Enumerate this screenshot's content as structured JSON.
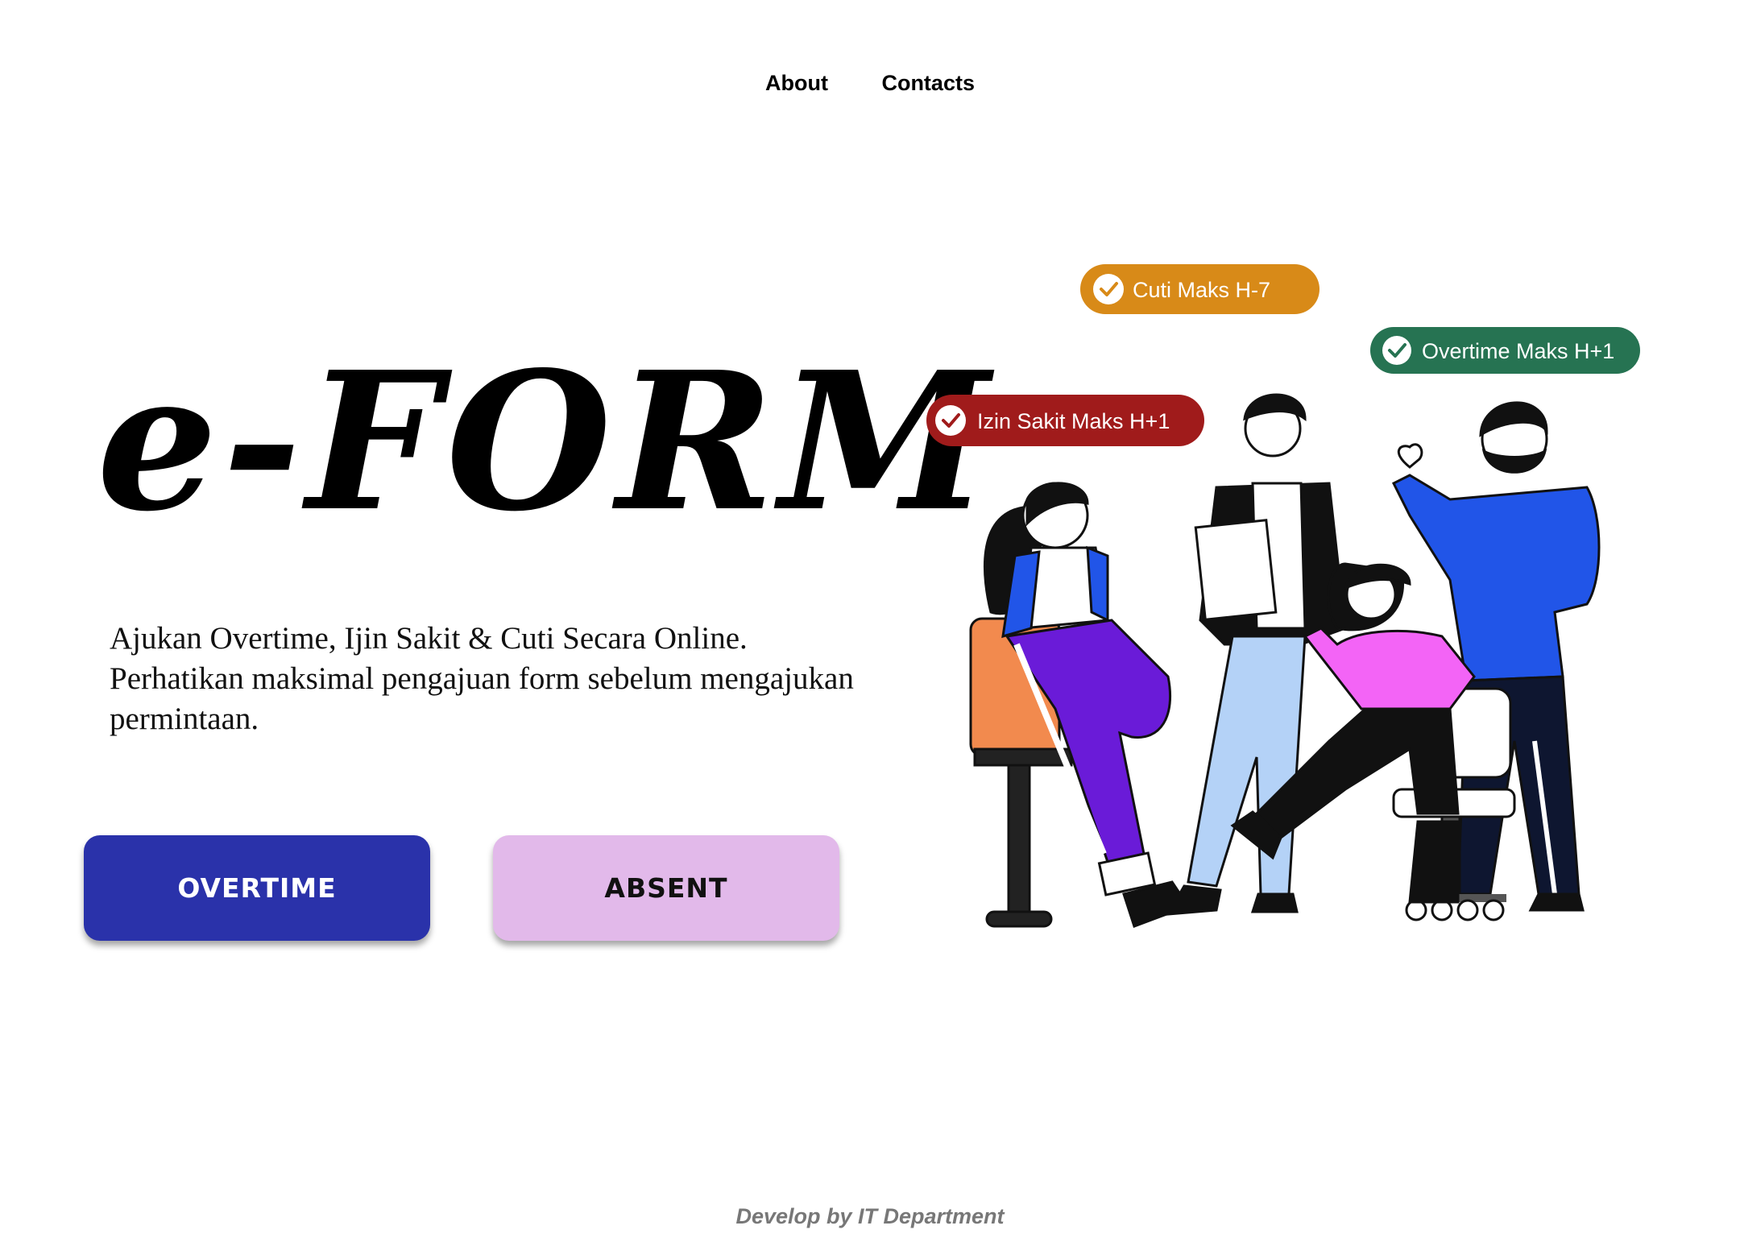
{
  "nav": {
    "about": "About",
    "contacts": "Contacts"
  },
  "hero": {
    "title": "e-FORM",
    "description": "Ajukan Overtime, Ijin Sakit & Cuti Secara Online. Perhatikan maksimal pengajuan form sebelum mengajukan permintaan."
  },
  "buttons": {
    "overtime": "OVERTIME",
    "absent": "ABSENT"
  },
  "badges": [
    {
      "label": "Cuti Maks H-7",
      "color": "#d88a18"
    },
    {
      "label": "Overtime Maks H+1",
      "color": "#267352"
    },
    {
      "label": "Izin Sakit Maks H+1",
      "color": "#a01b1b"
    }
  ],
  "footer": {
    "credit": "Develop by IT Department"
  },
  "colors": {
    "overtime_button": "#2a32aa",
    "absent_button": "#e2b9ea"
  }
}
